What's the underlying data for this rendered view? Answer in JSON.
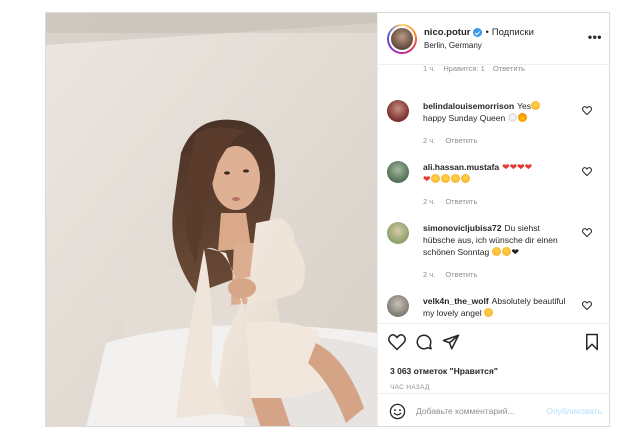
{
  "header": {
    "username": "nico.potur",
    "separator": "•",
    "follow_label": "Подписки",
    "location": "Berlin, Germany",
    "more_label": "•••"
  },
  "partial_comment": {
    "time": "1 ч.",
    "likes": "Нравится: 1",
    "reply": "Ответить"
  },
  "comments": [
    {
      "username": "belindalouisemorrison",
      "text_1": "Yes",
      "text_2": "happy Sunday Queen",
      "time": "2 ч.",
      "reply": "Ответить",
      "avatar_color": "#7a2e2e"
    },
    {
      "username": "ali.hassan.mustafa",
      "time": "2 ч.",
      "reply": "Ответить",
      "avatar_color": "#4f6f52"
    },
    {
      "username": "simonoviclјubisa72",
      "text": "Du siehst hübsche aus, ich wünsche dir einen schönen Sonntag",
      "time": "2 ч.",
      "reply": "Ответить",
      "avatar_color": "#8aa06a"
    },
    {
      "username": "velk4n_the_wolf",
      "text": "Absolutely beautiful my lovely angel",
      "avatar_color": "#7d7a72"
    }
  ],
  "actions": {
    "likes_label": "3 063 отметок \"Нравится\"",
    "time_label": "ЧАС НАЗАД"
  },
  "composer": {
    "placeholder": "Добавьте комментарий...",
    "publish_label": "Опубликовать"
  },
  "icons": [
    "heart-icon",
    "comment-icon",
    "share-icon",
    "bookmark-icon",
    "emoji-icon",
    "verified-icon",
    "more-icon"
  ],
  "colors": {
    "verified": "#3897f0",
    "publish_disabled": "#b2dffc",
    "meta_text": "#8e8e8e"
  }
}
